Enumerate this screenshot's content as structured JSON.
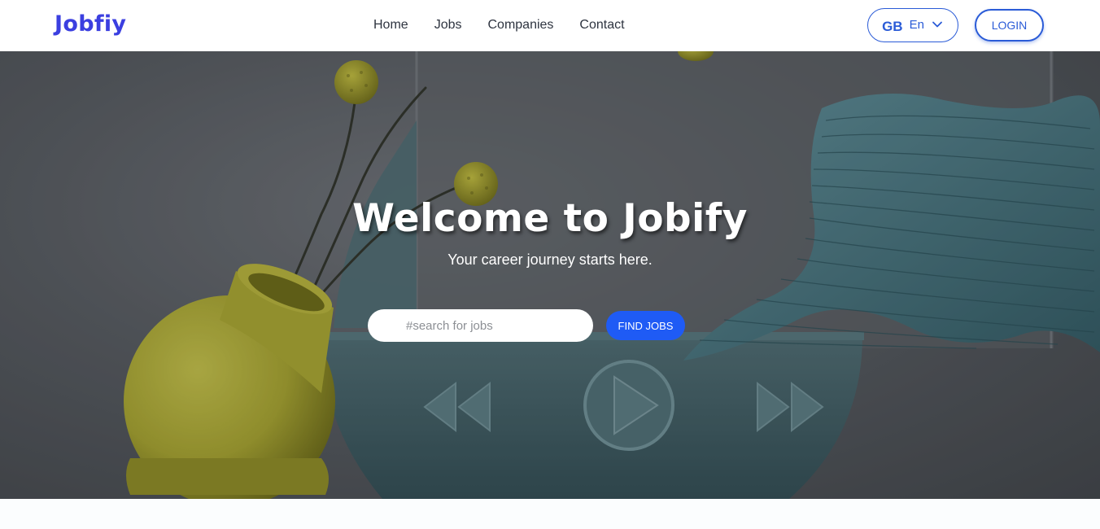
{
  "brand": {
    "logo_text": "Jobfiy"
  },
  "nav": {
    "items": [
      {
        "label": "Home"
      },
      {
        "label": "Jobs"
      },
      {
        "label": "Companies"
      },
      {
        "label": "Contact"
      }
    ]
  },
  "language": {
    "flag": "GB",
    "code": "En"
  },
  "login": {
    "label": "LOGIN"
  },
  "hero": {
    "title": "Welcome to Jobify",
    "subtitle": "Your career journey starts here.",
    "search_placeholder": "#search for jobs",
    "find_label": "FIND JOBS"
  },
  "colors": {
    "brand": "#3b3fe0",
    "accent": "#1f5bf5",
    "outline": "#2a5bd7"
  },
  "icons": {
    "chevron": "chevron-down-icon",
    "rewind": "rewind-icon",
    "play": "play-icon",
    "fast_forward": "fast-forward-icon"
  }
}
